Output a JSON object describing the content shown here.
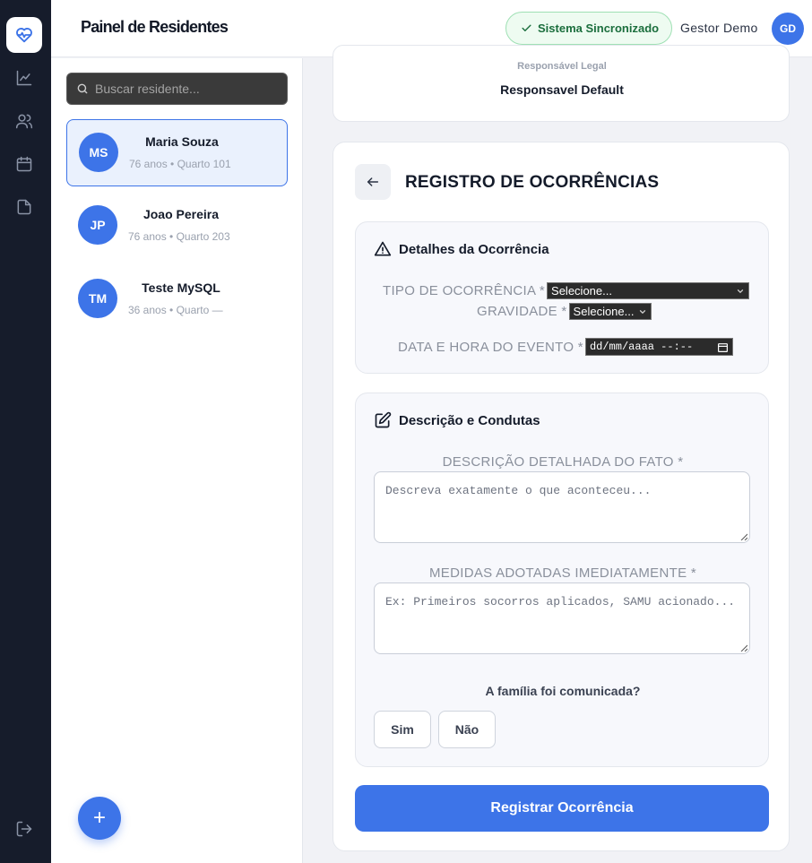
{
  "app": {
    "title": "Painel de Residentes",
    "accent_color": "#3d74e8",
    "rail_color": "#161c2b"
  },
  "rail": {
    "items": [
      {
        "icon": "heart-pulse-icon",
        "active": true
      },
      {
        "icon": "chart-line-icon"
      },
      {
        "icon": "users-icon"
      },
      {
        "icon": "calendar-icon"
      },
      {
        "icon": "file-icon"
      }
    ],
    "logout_icon": "logout-icon"
  },
  "header": {
    "sync_status": "Sistema Sincronizado",
    "user_name": "Gestor Demo",
    "user_initials": "GD"
  },
  "sidebar": {
    "search_placeholder": "Buscar residente...",
    "residents": [
      {
        "initials": "MS",
        "name": "Maria Souza",
        "meta": "76 anos • Quarto 101",
        "selected": true
      },
      {
        "initials": "JP",
        "name": "Joao Pereira",
        "meta": "76 anos • Quarto 203",
        "selected": false
      },
      {
        "initials": "TM",
        "name": "Teste MySQL",
        "meta": "36 anos • Quarto —",
        "selected": false
      }
    ],
    "add_label": "+"
  },
  "profile_card": {
    "label": "Responsável Legal",
    "value": "Responsavel Default"
  },
  "form": {
    "title": "REGISTRO DE OCORRÊNCIAS",
    "details": {
      "heading": "Detalhes da Ocorrência",
      "type_label": "TIPO DE OCORRÊNCIA *",
      "type_value": "Selecione...",
      "severity_label": "GRAVIDADE *",
      "severity_value": "Selecione...",
      "datetime_label": "DATA E HORA DO EVENTO *",
      "datetime_value": "dd/mm/aaaa --:--"
    },
    "description": {
      "heading": "Descrição e Condutas",
      "fact_label": "DESCRIÇÃO DETALHADA DO FATO *",
      "fact_placeholder": "Descreva exatamente o que aconteceu...",
      "measures_label": "MEDIDAS ADOTADAS IMEDIATAMENTE *",
      "measures_placeholder": "Ex: Primeiros socorros aplicados, SAMU acionado...",
      "family_question": "A família foi comunicada?",
      "yes_label": "Sim",
      "no_label": "Não"
    },
    "submit_label": "Registrar Ocorrência"
  }
}
